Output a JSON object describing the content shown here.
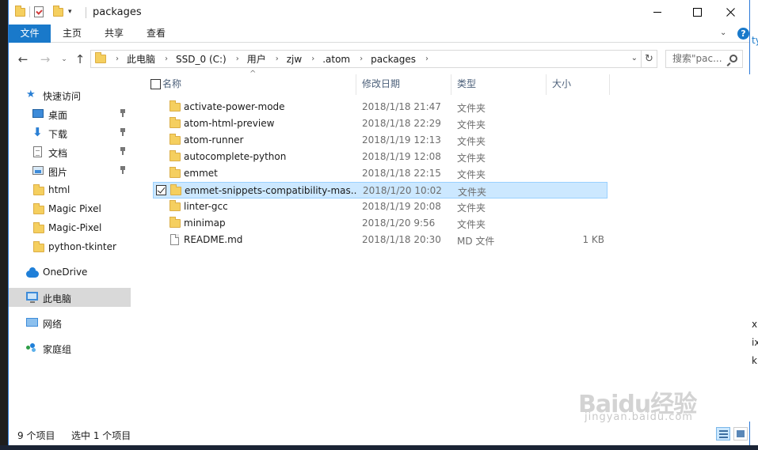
{
  "window": {
    "title": "packages"
  },
  "ribbon": {
    "tabs": [
      {
        "label": "文件"
      },
      {
        "label": "主页"
      },
      {
        "label": "共享"
      },
      {
        "label": "查看"
      }
    ],
    "help": "?"
  },
  "address": {
    "crumbs": [
      "此电脑",
      "SSD_0 (C:)",
      "用户",
      "zjw",
      ".atom",
      "packages"
    ],
    "search_placeholder": "搜索\"pac..."
  },
  "sidebar": {
    "items": [
      {
        "label": "快速访问",
        "icon": "star-icon"
      },
      {
        "label": "桌面",
        "icon": "desktop-icon",
        "pinned": true
      },
      {
        "label": "下载",
        "icon": "download-icon",
        "pinned": true
      },
      {
        "label": "文档",
        "icon": "document-icon",
        "pinned": true
      },
      {
        "label": "图片",
        "icon": "pictures-icon",
        "pinned": true
      },
      {
        "label": "html",
        "icon": "folder-icon"
      },
      {
        "label": "Magic Pixel",
        "icon": "folder-icon"
      },
      {
        "label": "Magic-Pixel",
        "icon": "folder-icon"
      },
      {
        "label": "python-tkinter",
        "icon": "folder-icon"
      },
      {
        "label": "OneDrive",
        "icon": "cloud-icon"
      },
      {
        "label": "此电脑",
        "icon": "computer-icon",
        "selected": true
      },
      {
        "label": "网络",
        "icon": "network-icon"
      },
      {
        "label": "家庭组",
        "icon": "homegroup-icon"
      }
    ]
  },
  "list": {
    "columns": [
      "名称",
      "修改日期",
      "类型",
      "大小"
    ],
    "rows": [
      {
        "name": "activate-power-mode",
        "date": "2018/1/18 21:47",
        "type": "文件夹",
        "size": "",
        "kind": "folder"
      },
      {
        "name": "atom-html-preview",
        "date": "2018/1/18 22:29",
        "type": "文件夹",
        "size": "",
        "kind": "folder"
      },
      {
        "name": "atom-runner",
        "date": "2018/1/19 12:13",
        "type": "文件夹",
        "size": "",
        "kind": "folder"
      },
      {
        "name": "autocomplete-python",
        "date": "2018/1/19 12:08",
        "type": "文件夹",
        "size": "",
        "kind": "folder"
      },
      {
        "name": "emmet",
        "date": "2018/1/18 22:15",
        "type": "文件夹",
        "size": "",
        "kind": "folder"
      },
      {
        "name": "emmet-snippets-compatibility-mas...",
        "date": "2018/1/20 10:02",
        "type": "文件夹",
        "size": "",
        "kind": "folder",
        "selected": true
      },
      {
        "name": "linter-gcc",
        "date": "2018/1/19 20:08",
        "type": "文件夹",
        "size": "",
        "kind": "folder"
      },
      {
        "name": "minimap",
        "date": "2018/1/20 9:56",
        "type": "文件夹",
        "size": "",
        "kind": "folder"
      },
      {
        "name": "README.md",
        "date": "2018/1/18 20:30",
        "type": "MD 文件",
        "size": "1 KB",
        "kind": "file"
      }
    ]
  },
  "status": {
    "item_count": "9 个项目",
    "selection": "选中 1 个项目"
  },
  "background_fragments": [
    "ty",
    "x",
    "ix",
    "k"
  ],
  "watermark": {
    "brand": "Baidu经验",
    "url": "jingyan.baidu.com"
  },
  "colors": {
    "accent": "#1979ca",
    "selection": "#cce8ff",
    "folder": "#f5cf5f"
  }
}
